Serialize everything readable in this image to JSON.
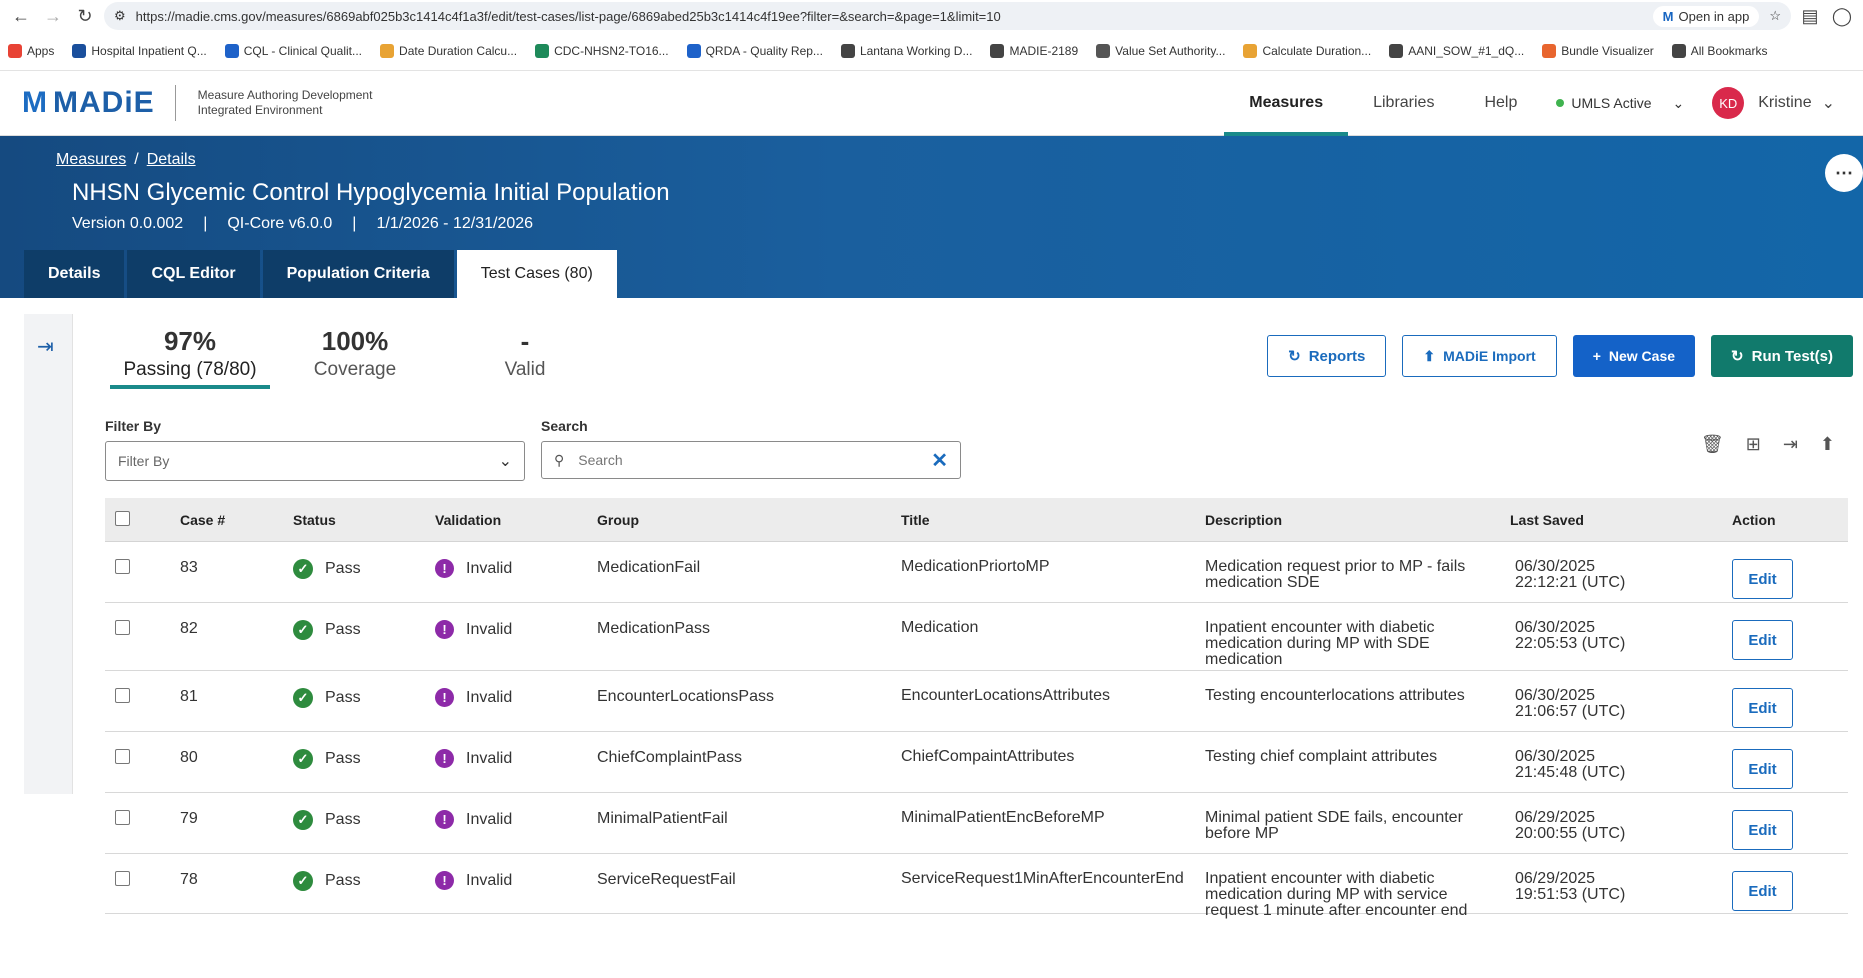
{
  "browser": {
    "url": "https://madie.cms.gov/measures/6869abf025b3c1414c4f1a3f/edit/test-cases/list-page/6869abed25b3c1414c4f19ee?filter=&search=&page=1&limit=10",
    "open_in_app": "Open in app",
    "bookmarks": [
      {
        "label": "Apps",
        "color": "#e84335"
      },
      {
        "label": "Hospital Inpatient Q...",
        "color": "#1a4f9c"
      },
      {
        "label": "CQL - Clinical Qualit...",
        "color": "#1e62c9"
      },
      {
        "label": "Date Duration Calcu...",
        "color": "#e8a334"
      },
      {
        "label": "CDC-NHSN2-TO16...",
        "color": "#1e8a5a"
      },
      {
        "label": "QRDA - Quality Rep...",
        "color": "#1e62c9"
      },
      {
        "label": "Lantana Working D...",
        "color": "#444444"
      },
      {
        "label": "MADIE-2189",
        "color": "#444444"
      },
      {
        "label": "Value Set Authority...",
        "color": "#555555"
      },
      {
        "label": "Calculate Duration...",
        "color": "#e8a334"
      },
      {
        "label": "AANI_SOW_#1_dQ...",
        "color": "#444444"
      },
      {
        "label": "Bundle Visualizer",
        "color": "#e8652e"
      },
      {
        "label": "All Bookmarks",
        "color": "#444444"
      }
    ]
  },
  "header": {
    "logo": "MADiE",
    "subtitle_line1": "Measure Authoring Development",
    "subtitle_line2": "Integrated Environment",
    "nav": [
      "Measures",
      "Libraries",
      "Help"
    ],
    "umls": "UMLS Active",
    "avatar_initials": "KD",
    "user_name": "Kristine"
  },
  "banner": {
    "breadcrumb": [
      "Measures",
      "Details"
    ],
    "title": "NHSN Glycemic Control Hypoglycemia Initial Population",
    "version": "Version 0.0.002",
    "model": "QI-Core v6.0.0",
    "period": "1/1/2026 - 12/31/2026",
    "tabs": [
      "Details",
      "CQL Editor",
      "Population Criteria",
      "Test Cases (80)"
    ]
  },
  "stats": {
    "passing_value": "97%",
    "passing_label": "Passing (78/80)",
    "coverage_value": "100%",
    "coverage_label": "Coverage",
    "valid_value": "-",
    "valid_label": "Valid"
  },
  "actions": {
    "reports": "Reports",
    "import": "MADiE Import",
    "new_case": "New Case",
    "run_tests": "Run Test(s)"
  },
  "filters": {
    "filter_label": "Filter By",
    "filter_placeholder": "Filter By",
    "search_label": "Search",
    "search_placeholder": "Search"
  },
  "table": {
    "headers": [
      "Case #",
      "Status",
      "Validation",
      "Group",
      "Title",
      "Description",
      "Last Saved",
      "Action"
    ],
    "rows": [
      {
        "case": "83",
        "status": "Pass",
        "validation": "Invalid",
        "group": "MedicationFail",
        "title": "MedicationPriortoMP",
        "description": "Medication request prior to MP - fails medication SDE",
        "saved_date": "06/30/2025",
        "saved_time": "22:12:21 (UTC)",
        "action": "Edit"
      },
      {
        "case": "82",
        "status": "Pass",
        "validation": "Invalid",
        "group": "MedicationPass",
        "title": "Medication",
        "description": "Inpatient encounter with diabetic medication during MP with SDE medication",
        "saved_date": "06/30/2025",
        "saved_time": "22:05:53 (UTC)",
        "action": "Edit"
      },
      {
        "case": "81",
        "status": "Pass",
        "validation": "Invalid",
        "group": "EncounterLocationsPass",
        "title": "EncounterLocationsAttributes",
        "description": "Testing encounterlocations attributes",
        "saved_date": "06/30/2025",
        "saved_time": "21:06:57 (UTC)",
        "action": "Edit"
      },
      {
        "case": "80",
        "status": "Pass",
        "validation": "Invalid",
        "group": "ChiefComplaintPass",
        "title": "ChiefCompaintAttributes",
        "description": "Testing chief complaint attributes",
        "saved_date": "06/30/2025",
        "saved_time": "21:45:48 (UTC)",
        "action": "Edit"
      },
      {
        "case": "79",
        "status": "Pass",
        "validation": "Invalid",
        "group": "MinimalPatientFail",
        "title": "MinimalPatientEncBeforeMP",
        "description": "Minimal patient SDE fails, encounter before MP",
        "saved_date": "06/29/2025",
        "saved_time": "20:00:55 (UTC)",
        "action": "Edit"
      },
      {
        "case": "78",
        "status": "Pass",
        "validation": "Invalid",
        "group": "ServiceRequestFail",
        "title": "ServiceRequest1MinAfterEncounterEnd",
        "description": "Inpatient encounter with diabetic medication during MP with service request 1 minute after encounter end",
        "saved_date": "06/29/2025",
        "saved_time": "19:51:53 (UTC)",
        "action": "Edit"
      }
    ]
  },
  "colors": {
    "primary": "#1462c8",
    "teal": "#117a6c",
    "pass": "#2e8b3e",
    "invalid": "#8d2aa8"
  }
}
